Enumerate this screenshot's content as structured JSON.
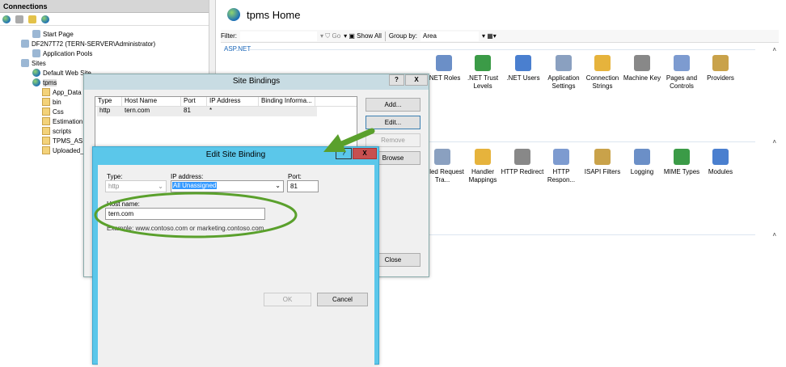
{
  "connections": {
    "header": "Connections",
    "tree": [
      {
        "label": "Start Page",
        "icon": "start-page-icon"
      },
      {
        "label": "DF2N7T72 (TERN-SERVER\\Administrator)",
        "icon": "server-icon"
      },
      {
        "label": "Application Pools",
        "icon": "app-pools-icon"
      },
      {
        "label": "Sites",
        "icon": "sites-icon"
      },
      {
        "label": "Default Web Site",
        "icon": "globe-icon"
      },
      {
        "label": "tpms",
        "icon": "globe-icon"
      },
      {
        "label": "App_Data",
        "icon": "folder-icon"
      },
      {
        "label": "bin",
        "icon": "folder-icon"
      },
      {
        "label": "Css",
        "icon": "folder-icon"
      },
      {
        "label": "Estimation",
        "icon": "folder-icon"
      },
      {
        "label": "scripts",
        "icon": "folder-icon"
      },
      {
        "label": "TPMS_ASP",
        "icon": "folder-icon"
      },
      {
        "label": "Uploaded_",
        "icon": "folder-icon"
      }
    ]
  },
  "main": {
    "title": "tpms Home",
    "filter": {
      "label": "Filter:",
      "go": "Go",
      "show_all": "Show All",
      "group_by_label": "Group by:",
      "group_by_value": "Area"
    },
    "groups": [
      {
        "name": "ASP.NET"
      }
    ],
    "row1": [
      ".NET Roles",
      ".NET Trust Levels",
      ".NET Users",
      "Application Settings",
      "Connection Strings",
      "Machine Key",
      "Pages and Controls",
      "Providers"
    ],
    "row2": [
      "Failed Request Tra...",
      "Handler Mappings",
      "HTTP Redirect",
      "HTTP Respon...",
      "ISAPI Filters",
      "Logging",
      "MIME Types",
      "Modules"
    ]
  },
  "site_bindings": {
    "title": "Site Bindings",
    "help": "?",
    "close_x": "X",
    "columns": [
      "Type",
      "Host Name",
      "Port",
      "IP Address",
      "Binding Informa..."
    ],
    "rows": [
      [
        "http",
        "tern.com",
        "81",
        "*",
        ""
      ]
    ],
    "buttons": {
      "add": "Add...",
      "edit": "Edit...",
      "remove": "Remove",
      "browse": "Browse",
      "close": "Close"
    }
  },
  "edit_binding": {
    "title": "Edit Site Binding",
    "help": "?",
    "close_x": "X",
    "type_label": "Type:",
    "type_value": "http",
    "ip_label": "IP address:",
    "ip_value": "All Unassigned",
    "port_label": "Port:",
    "port_value": "81",
    "host_label": "Host name:",
    "host_value": "tern.com",
    "example": "Example: www.contoso.com or marketing.contoso.com",
    "ok": "OK",
    "cancel": "Cancel"
  },
  "colors": {
    "annotation": "#5aa02c",
    "dialog_title_active": "#5bc7ea",
    "close_red": "#c75050",
    "selection": "#3399ff"
  }
}
